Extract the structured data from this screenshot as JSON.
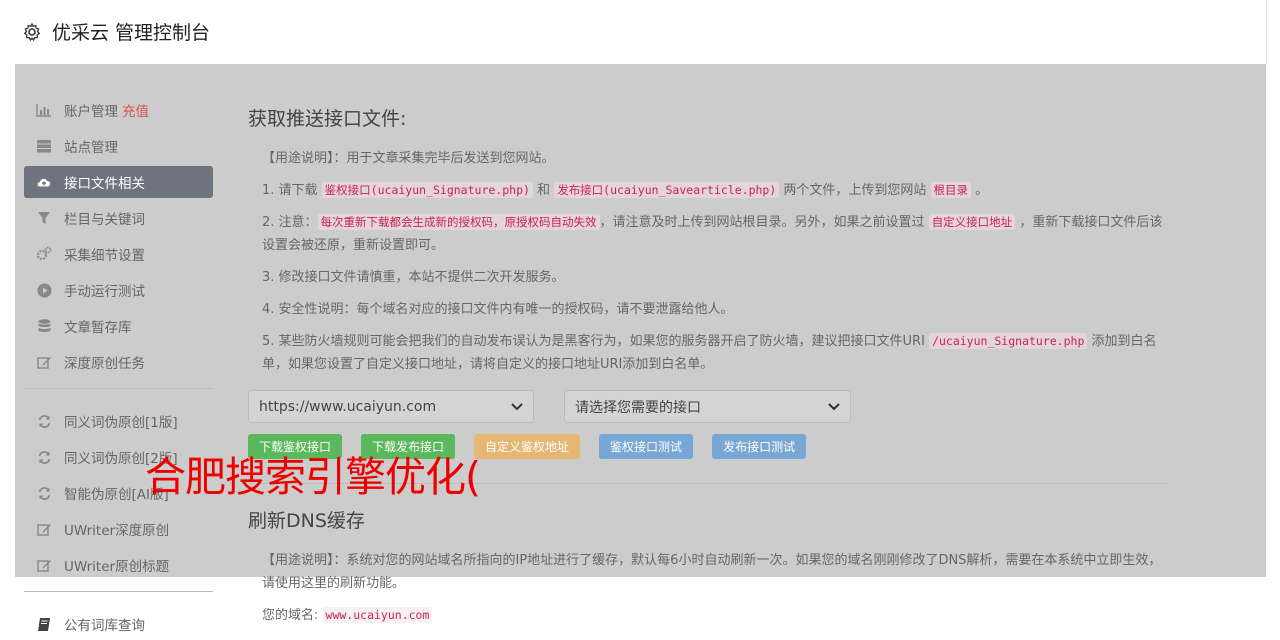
{
  "header": {
    "title": "优采云 管理控制台",
    "icon": "gear-icon"
  },
  "sidebar": {
    "items": [
      {
        "label": "账户管理",
        "extra": "充值",
        "icon": "bar-chart-icon"
      },
      {
        "label": "站点管理",
        "icon": "server-icon"
      },
      {
        "label": "接口文件相关",
        "icon": "cloud-upload-icon",
        "active": true
      },
      {
        "label": "栏目与关键词",
        "icon": "filter-icon"
      },
      {
        "label": "采集细节设置",
        "icon": "cogs-icon"
      },
      {
        "label": "手动运行测试",
        "icon": "play-circle-icon"
      },
      {
        "label": "文章暂存库",
        "icon": "database-icon"
      },
      {
        "label": "深度原创任务",
        "icon": "edit-icon"
      },
      {
        "label": "同义词伪原创[1版]",
        "icon": "refresh-icon"
      },
      {
        "label": "同义词伪原创[2版]",
        "icon": "refresh-icon"
      },
      {
        "label": "智能伪原创[AI版]",
        "icon": "refresh-icon"
      },
      {
        "label": "UWriter深度原创",
        "icon": "edit-icon"
      },
      {
        "label": "UWriter原创标题",
        "icon": "edit-icon"
      },
      {
        "label": "公有词库查询",
        "icon": "book-icon"
      }
    ]
  },
  "main": {
    "section1": {
      "title": "获取推送接口文件:",
      "usage": "【用途说明】：用于文章采集完毕后发送到您网站。",
      "p1": {
        "a": "1. 请下载 ",
        "code1": "鉴权接口(ucaiyun_Signature.php)",
        "b": " 和 ",
        "code2": "发布接口(ucaiyun_Savearticle.php)",
        "c": " 两个文件，上传到您网站 ",
        "code3": "根目录",
        "d": " 。"
      },
      "p2": {
        "a": "2. 注意：",
        "code1": "每次重新下载都会生成新的授权码，原授权码自动失效",
        "b": "，请注意及时上传到网站根目录。另外，如果之前设置过 ",
        "code2": "自定义接口地址",
        "c": " ，重新下载接口文件后该设置会被还原，重新设置即可。"
      },
      "p3": "3. 修改接口文件请慎重，本站不提供二次开发服务。",
      "p4": "4. 安全性说明：每个域名对应的接口文件内有唯一的授权码，请不要泄露给他人。",
      "p5": {
        "a": "5. 某些防火墙规则可能会把我们的自动发布误认为是黑客行为，如果您的服务器开启了防火墙，建议把接口文件URI ",
        "code1": "/ucaiyun_Signature.php",
        "b": " 添加到白名单，如果您设置了自定义接口地址，请将自定义的接口地址URI添加到白名单。"
      },
      "site_select": "https://www.ucaiyun.com",
      "api_select": "请选择您需要的接口",
      "buttons": [
        "下载鉴权接口",
        "下载发布接口",
        "自定义鉴权地址",
        "鉴权接口测试",
        "发布接口测试"
      ]
    },
    "section2": {
      "title": "刷新DNS缓存",
      "usage": "【用途说明】：系统对您的网站域名所指向的IP地址进行了缓存，默认每6小时自动刷新一次。如果您的域名刚刚修改了DNS解析，需要在本系统中立即生效，请使用这里的刷新功能。",
      "domain_label": "您的域名:",
      "domain_value": "www.ucaiyun.com"
    }
  },
  "watermark": "合肥搜索引擎优化("
}
